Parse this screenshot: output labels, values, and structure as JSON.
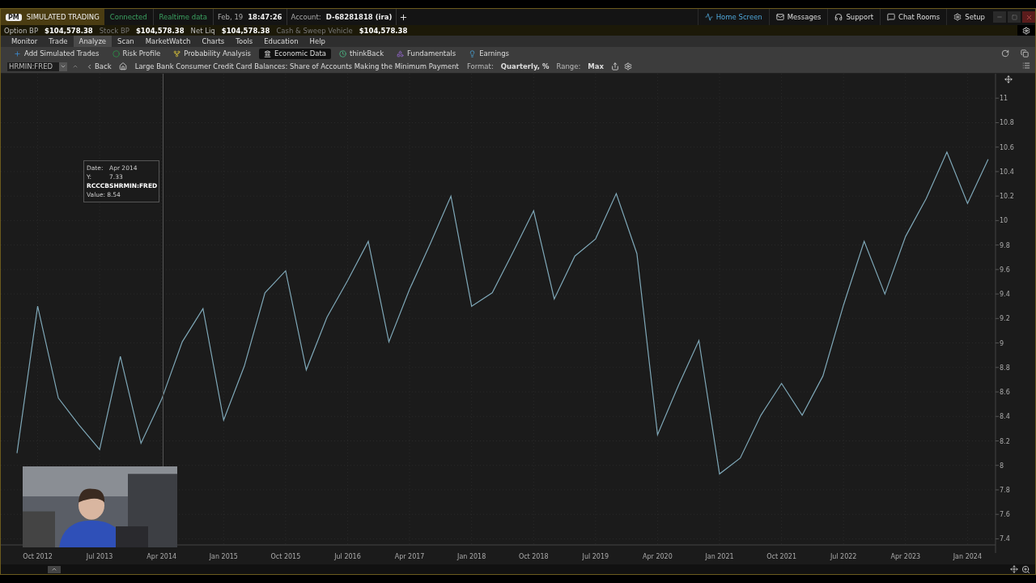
{
  "title_bar": {
    "badge": "PM",
    "mode": "SIMULATED TRADING",
    "status": [
      "Connected",
      "Realtime data"
    ],
    "date": "Feb, 19",
    "time": "18:47:26",
    "account_label": "Account:",
    "account": "D-68281818 (ira)",
    "links": [
      {
        "label": "Home Screen",
        "selected": true
      },
      {
        "label": "Messages",
        "selected": false
      },
      {
        "label": "Support",
        "selected": false
      },
      {
        "label": "Chat Rooms",
        "selected": false
      },
      {
        "label": "Setup",
        "selected": false
      }
    ]
  },
  "balances": [
    {
      "label": "Option BP",
      "value": "$104,578.38",
      "dim": false
    },
    {
      "label": "Stock BP",
      "value": "$104,578.38",
      "dim": true
    },
    {
      "label": "Net Liq",
      "value": "$104,578.38",
      "dim": false
    },
    {
      "label": "Cash & Sweep Vehicle",
      "value": "$104,578.38",
      "dim": true
    }
  ],
  "menu": [
    {
      "label": "Monitor",
      "selected": false
    },
    {
      "label": "Trade",
      "selected": false
    },
    {
      "label": "Analyze",
      "selected": true
    },
    {
      "label": "Scan",
      "selected": false
    },
    {
      "label": "MarketWatch",
      "selected": false
    },
    {
      "label": "Charts",
      "selected": false
    },
    {
      "label": "Tools",
      "selected": false
    },
    {
      "label": "Education",
      "selected": false
    },
    {
      "label": "Help",
      "selected": false
    }
  ],
  "subtabs": [
    {
      "label": "Add Simulated Trades",
      "selected": false
    },
    {
      "label": "Risk Profile",
      "selected": false
    },
    {
      "label": "Probability Analysis",
      "selected": false
    },
    {
      "label": "Economic Data",
      "selected": true
    },
    {
      "label": "thinkBack",
      "selected": false
    },
    {
      "label": "Fundamentals",
      "selected": false
    },
    {
      "label": "Earnings",
      "selected": false
    }
  ],
  "chart_toolbar": {
    "symbol": "HRMIN:FRED",
    "back": "Back",
    "title": "Large Bank Consumer Credit Card Balances: Share of Accounts Making the Minimum Payment",
    "format_label": "Format:",
    "format": "Quarterly, %",
    "range_label": "Range:",
    "range": "Max"
  },
  "chart": {
    "chart_data": {
      "type": "line",
      "categories": [
        null,
        "Oct 2012",
        null,
        null,
        "Jul 2013",
        null,
        null,
        "Apr 2014",
        null,
        null,
        "Jan 2015",
        null,
        null,
        "Oct 2015",
        null,
        null,
        "Jul 2016",
        null,
        null,
        "Apr 2017",
        null,
        null,
        "Jan 2018",
        null,
        null,
        "Oct 2018",
        null,
        null,
        "Jul 2019",
        null,
        null,
        "Apr 2020",
        null,
        null,
        "Jan 2021",
        null,
        null,
        "Oct 2021",
        null,
        null,
        "Jul 2022",
        null,
        null,
        "Apr 2023",
        null,
        null,
        "Jan 2024",
        null
      ],
      "grid": true,
      "series": [
        {
          "name": "RCCCBSHRMIN:FRED",
          "color": "#7fa8b8",
          "values": [
            8.1,
            9.3,
            8.55,
            8.33,
            8.13,
            8.89,
            8.18,
            8.54,
            9.01,
            9.28,
            8.37,
            8.81,
            9.41,
            9.59,
            8.78,
            9.21,
            9.51,
            9.83,
            9.01,
            9.44,
            9.81,
            10.2,
            9.3,
            9.41,
            9.74,
            10.08,
            9.36,
            9.71,
            9.85,
            10.22,
            9.73,
            8.25,
            8.65,
            9.02,
            7.93,
            8.06,
            8.41,
            8.67,
            8.41,
            8.73,
            9.31,
            9.83,
            9.4,
            9.87,
            10.18,
            10.56,
            10.14,
            10.5
          ]
        }
      ],
      "ylim": [
        7.35,
        11.2
      ],
      "yticks": [
        {
          "value": 11,
          "label": "11"
        },
        {
          "value": 10.8,
          "label": "10.8"
        },
        {
          "value": 10.6,
          "label": "10.6"
        },
        {
          "value": 10.4,
          "label": "10.4"
        },
        {
          "value": 10.2,
          "label": "10.2"
        },
        {
          "value": 10,
          "label": "10"
        },
        {
          "value": 9.8,
          "label": "9.8"
        },
        {
          "value": 9.6,
          "label": "9.6"
        },
        {
          "value": 9.4,
          "label": "9.4"
        },
        {
          "value": 9.2,
          "label": "9.2"
        },
        {
          "value": 9,
          "label": "9"
        },
        {
          "value": 8.8,
          "label": "8.8"
        },
        {
          "value": 8.6,
          "label": "8.6"
        },
        {
          "value": 8.4,
          "label": "8.4"
        },
        {
          "value": 8.2,
          "label": "8.2"
        },
        {
          "value": 8,
          "label": "8"
        },
        {
          "value": 7.8,
          "label": "7.8"
        },
        {
          "value": 7.6,
          "label": "7.6"
        },
        {
          "value": 7.4,
          "label": "7.4"
        }
      ]
    },
    "tooltip": {
      "rows": [
        {
          "label": "Date:",
          "value": "Apr 2014"
        },
        {
          "label": "Y:",
          "value": "7.33"
        }
      ],
      "value_label": "Value:",
      "value": "8.54"
    }
  }
}
